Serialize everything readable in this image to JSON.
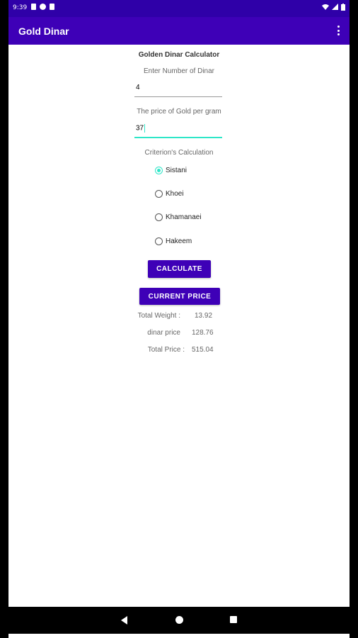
{
  "status_bar": {
    "time": "9:39"
  },
  "app_bar": {
    "title": "Gold Dinar"
  },
  "calculator": {
    "title": "Golden Dinar Calculator",
    "dinar_label": "Enter Number of Dinar",
    "dinar_value": "4",
    "gold_price_label": "The price of Gold per gram",
    "gold_price_value": "37",
    "criterion_label": "Criterion's Calculation",
    "options": [
      {
        "label": "Sistani",
        "checked": true
      },
      {
        "label": "Khoei",
        "checked": false
      },
      {
        "label": "Khamanaei",
        "checked": false
      },
      {
        "label": "Hakeem",
        "checked": false
      }
    ],
    "calculate_label": "CALCULATE",
    "current_price_label": "CURRENT PRICE"
  },
  "results": {
    "total_weight_label": "Total Weight :",
    "total_weight_value": "13.92",
    "dinar_price_label": "dinar price",
    "dinar_price_value": "128.76",
    "total_price_label": "Total Price :",
    "total_price_value": "515.04"
  },
  "colors": {
    "primary": "#3e00b7",
    "status_bar": "#2f00a8",
    "accent": "#2ee6c8"
  }
}
